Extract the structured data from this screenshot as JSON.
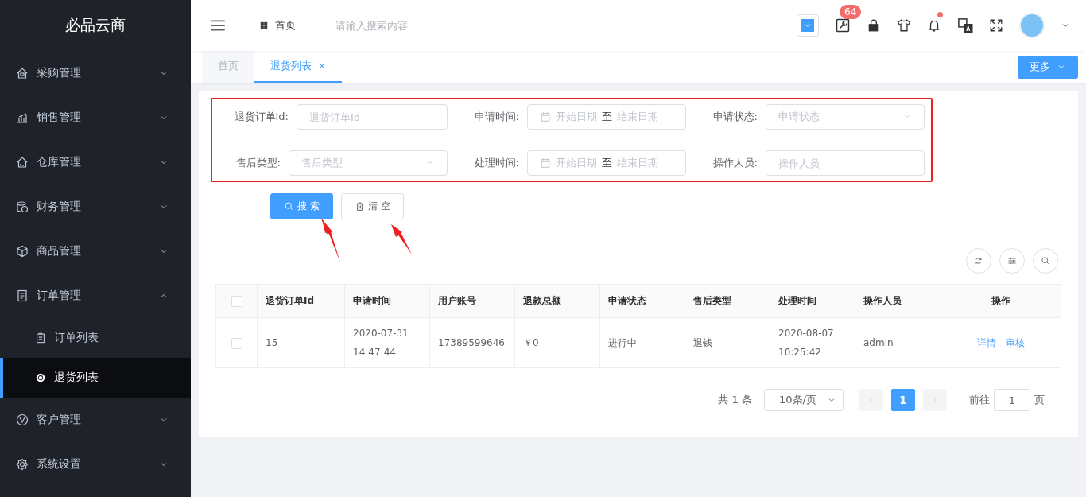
{
  "sidebar": {
    "logo": "必品云商",
    "items": [
      {
        "label": "采购管理",
        "expanded": false
      },
      {
        "label": "销售管理",
        "expanded": false
      },
      {
        "label": "仓库管理",
        "expanded": false
      },
      {
        "label": "财务管理",
        "expanded": false
      },
      {
        "label": "商品管理",
        "expanded": false
      },
      {
        "label": "订单管理",
        "expanded": true,
        "children": [
          {
            "label": "订单列表",
            "selected": false
          },
          {
            "label": "退货列表",
            "selected": true
          }
        ]
      },
      {
        "label": "客户管理",
        "expanded": false
      },
      {
        "label": "系统设置",
        "expanded": false
      }
    ]
  },
  "header": {
    "breadcrumb": "首页",
    "search": {
      "placeholder": "请输入搜索内容"
    },
    "tools_badge": "64",
    "bell_dot": true
  },
  "tabs": [
    {
      "label": "首页",
      "selected": false
    },
    {
      "label": "退货列表",
      "selected": true,
      "close": "×"
    }
  ],
  "more_button": "更多",
  "filters": [
    {
      "kind": "input",
      "label": "退货订单Id:",
      "placeholder": "退货订单Id"
    },
    {
      "kind": "daterange",
      "label": "申请时间:",
      "start_placeholder": "开始日期",
      "separator": "至",
      "end_placeholder": "结束日期"
    },
    {
      "kind": "select",
      "label": "申请状态:",
      "placeholder": "申请状态"
    },
    {
      "kind": "select",
      "label": "售后类型:",
      "placeholder": "售后类型"
    },
    {
      "kind": "daterange",
      "label": "处理时间:",
      "start_placeholder": "开始日期",
      "separator": "至",
      "end_placeholder": "结束日期"
    },
    {
      "kind": "input",
      "label": "操作人员:",
      "placeholder": "操作人员"
    }
  ],
  "buttons": {
    "search": "搜 索",
    "clear": "清 空"
  },
  "table": {
    "all_checked": false,
    "columns": [
      "退货订单Id",
      "申请时间",
      "用户账号",
      "退款总额",
      "申请状态",
      "售后类型",
      "处理时间",
      "操作人员",
      "操作"
    ],
    "rows": [
      {
        "checked": false,
        "cells": [
          "15",
          "2020-07-31 14:47:44",
          "17389599646",
          "￥0",
          "进行中",
          "退钱",
          "2020-08-07 10:25:42",
          "admin"
        ],
        "actions": [
          "详情",
          "审核"
        ]
      }
    ]
  },
  "pagination": {
    "total": "共 1 条",
    "page_size": "10条/页",
    "prev_disabled": true,
    "next_disabled": true,
    "pages": [
      {
        "label": "1",
        "selected": true
      }
    ],
    "goto_label": "前往",
    "goto_value": "1",
    "goto_suffix": "页"
  }
}
